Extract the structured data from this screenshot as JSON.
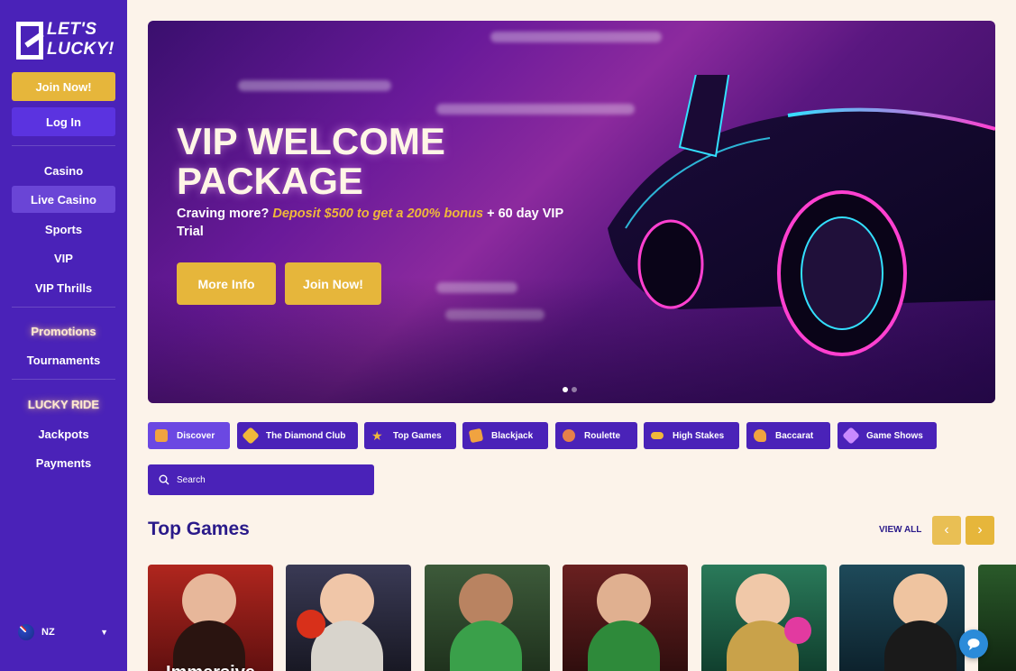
{
  "brand": {
    "logo_text_line1": "LET'S",
    "logo_text_line2": "LUCKY!"
  },
  "sidebar": {
    "join_label": "Join Now!",
    "login_label": "Log In",
    "nav": [
      {
        "label": "Casino",
        "active": false
      },
      {
        "label": "Live Casino",
        "active": true
      },
      {
        "label": "Sports",
        "active": false
      },
      {
        "label": "VIP",
        "active": false
      },
      {
        "label": "VIP Thrills",
        "active": false
      }
    ],
    "nav2": [
      {
        "label": "Promotions"
      },
      {
        "label": "Tournaments"
      }
    ],
    "nav3": [
      {
        "label": "LUCKY RIDE"
      },
      {
        "label": "Jackpots"
      },
      {
        "label": "Payments"
      }
    ],
    "language": {
      "code": "NZ",
      "icon": "nz-flag-icon"
    }
  },
  "hero": {
    "title": "VIP WELCOME PACKAGE",
    "subtitle_prefix": "Craving more?",
    "subtitle_highlight": "Deposit $500 to get a 200% bonus",
    "subtitle_suffix": "+ 60 day VIP Trial",
    "more_info_label": "More Info",
    "join_label": "Join Now!",
    "slides": 2,
    "active_slide": 1
  },
  "categories": [
    {
      "label": "Discover",
      "icon": "discover-icon",
      "color": "#f0a340",
      "active": true
    },
    {
      "label": "The Diamond Club",
      "icon": "diamond-icon",
      "color": "#f0b83a",
      "active": false
    },
    {
      "label": "Top Games",
      "icon": "star-icon",
      "color": "#f0b83a",
      "active": false
    },
    {
      "label": "Blackjack",
      "icon": "cards-icon",
      "color": "#f0a340",
      "active": false
    },
    {
      "label": "Roulette",
      "icon": "roulette-icon",
      "color": "#e6804a",
      "active": false
    },
    {
      "label": "High Stakes",
      "icon": "chips-icon",
      "color": "#f0b83a",
      "active": false
    },
    {
      "label": "Baccarat",
      "icon": "baccarat-icon",
      "color": "#f0a340",
      "active": false
    },
    {
      "label": "Game Shows",
      "icon": "gameshow-icon",
      "color": "#c98aff",
      "active": false
    }
  ],
  "search": {
    "placeholder": "Search"
  },
  "top_games": {
    "title": "Top Games",
    "view_all": "VIEW ALL",
    "cards": [
      {
        "label": "Immersive",
        "bg": "#8a1a1a"
      },
      {
        "label": "",
        "bg": "#2a2a3a"
      },
      {
        "label": "",
        "bg": "#2b5a3a"
      },
      {
        "label": "",
        "bg": "#5a2a2a"
      },
      {
        "label": "",
        "bg": "#2a6a4a"
      },
      {
        "label": "",
        "bg": "#1a4a5a"
      },
      {
        "label": "",
        "bg": "#2a4a2a"
      }
    ]
  },
  "colors": {
    "sidebar": "#4a22b8",
    "accent": "#e6b63b",
    "primary_dark": "#2a1a8a",
    "page_bg": "#fcf3ea"
  }
}
